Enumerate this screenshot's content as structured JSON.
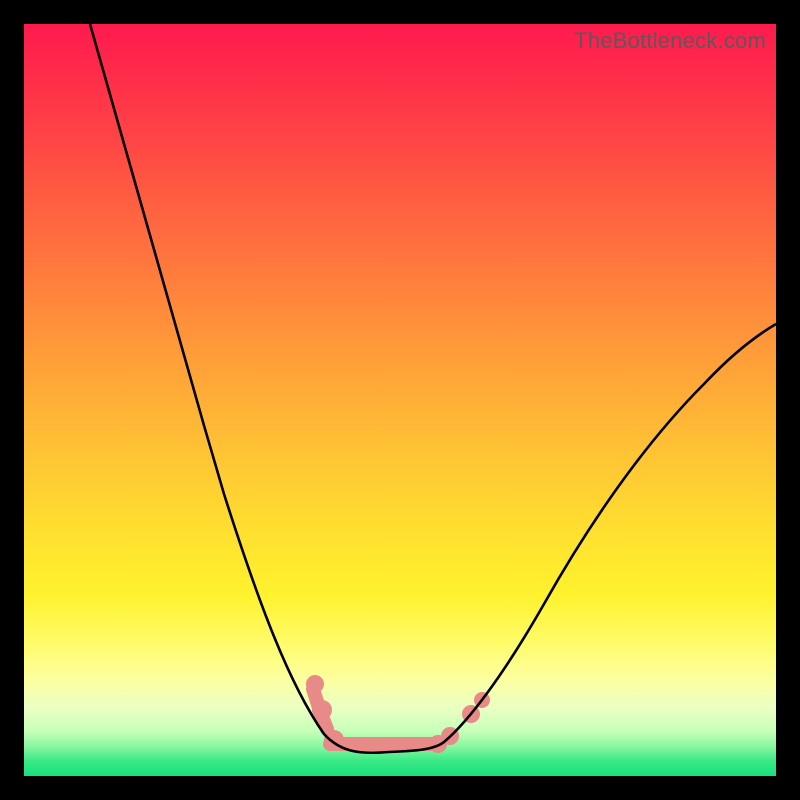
{
  "watermark": "TheBottleneck.com",
  "colors": {
    "frame": "#000000",
    "curve": "#000000",
    "marker": "#e88a88",
    "gradient_stops": [
      "#ff1a4f",
      "#ff4d44",
      "#ffa338",
      "#ffe12f",
      "#fdff9e",
      "#3ae986",
      "#17e07a"
    ]
  },
  "chart_data": {
    "type": "line",
    "title": "",
    "xlabel": "",
    "ylabel": "",
    "xlim": [
      0,
      100
    ],
    "ylim": [
      0,
      100
    ],
    "note": "x/y normalized to plot area 0–100; y=0 at bottom (green), y=100 at top (red). Curve is a V whose floor sits near y≈4 around x≈41–55; left arm rises steeply to y=100 at x≈9, right arm rises more gently reaching y≈60 at x=100.",
    "series": [
      {
        "name": "left-arm",
        "x": [
          9,
          12,
          15,
          18,
          21,
          24,
          27,
          30,
          33,
          36,
          38.5,
          41
        ],
        "y": [
          100,
          88,
          76,
          64.5,
          53.5,
          43.5,
          34.5,
          26.5,
          19.5,
          13.5,
          8.5,
          4.5
        ]
      },
      {
        "name": "floor",
        "x": [
          41,
          44,
          47,
          50,
          53,
          55
        ],
        "y": [
          4.5,
          3.5,
          3.2,
          3.2,
          3.5,
          4.2
        ]
      },
      {
        "name": "right-arm",
        "x": [
          55,
          58,
          61,
          65,
          70,
          75,
          80,
          85,
          90,
          95,
          100
        ],
        "y": [
          4.2,
          6.5,
          10,
          15.5,
          23,
          30,
          37,
          43.5,
          49.5,
          55,
          60
        ]
      }
    ],
    "markers": {
      "name": "highlighted-points",
      "color": "#e88a88",
      "points": [
        {
          "x": 38.5,
          "y": 10
        },
        {
          "x": 39.5,
          "y": 7
        },
        {
          "x": 41,
          "y": 4.8
        },
        {
          "x": 44,
          "y": 3.6
        },
        {
          "x": 47,
          "y": 3.2
        },
        {
          "x": 50,
          "y": 3.2
        },
        {
          "x": 53,
          "y": 3.4
        },
        {
          "x": 55,
          "y": 4.2
        },
        {
          "x": 56.5,
          "y": 5.2
        },
        {
          "x": 59,
          "y": 8
        },
        {
          "x": 60.5,
          "y": 10
        }
      ]
    }
  }
}
